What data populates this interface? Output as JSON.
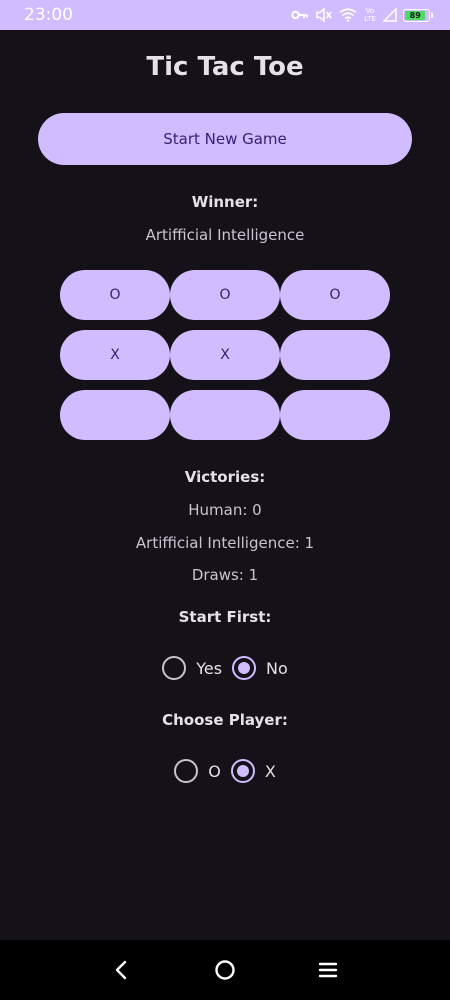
{
  "status_bar": {
    "time": "23:00",
    "network_label": "Vo LTE",
    "battery_level": "89"
  },
  "app": {
    "title": "Tic Tac Toe",
    "start_button_label": "Start New Game"
  },
  "winner": {
    "label": "Winner:",
    "value": "Artifficial Intelligence"
  },
  "board": {
    "cells": [
      "O",
      "O",
      "O",
      "X",
      "X",
      "",
      "",
      "",
      ""
    ]
  },
  "victories": {
    "label": "Victories:",
    "human": "Human: 0",
    "ai": "Artifficial Intelligence: 1",
    "draws": "Draws: 1"
  },
  "start_first": {
    "label": "Start First:",
    "options": [
      {
        "label": "Yes",
        "selected": false
      },
      {
        "label": "No",
        "selected": true
      }
    ]
  },
  "choose_player": {
    "label": "Choose Player:",
    "options": [
      {
        "label": "O",
        "selected": false
      },
      {
        "label": "X",
        "selected": true
      }
    ]
  },
  "icons": {
    "status": [
      "key-icon",
      "mute-icon",
      "wifi-icon",
      "signal-icon",
      "battery-icon"
    ],
    "nav": [
      "back-icon",
      "home-icon",
      "menu-icon"
    ]
  },
  "colors": {
    "accent": "#D0BCFF",
    "background": "#141218",
    "on_accent": "#381E72"
  }
}
